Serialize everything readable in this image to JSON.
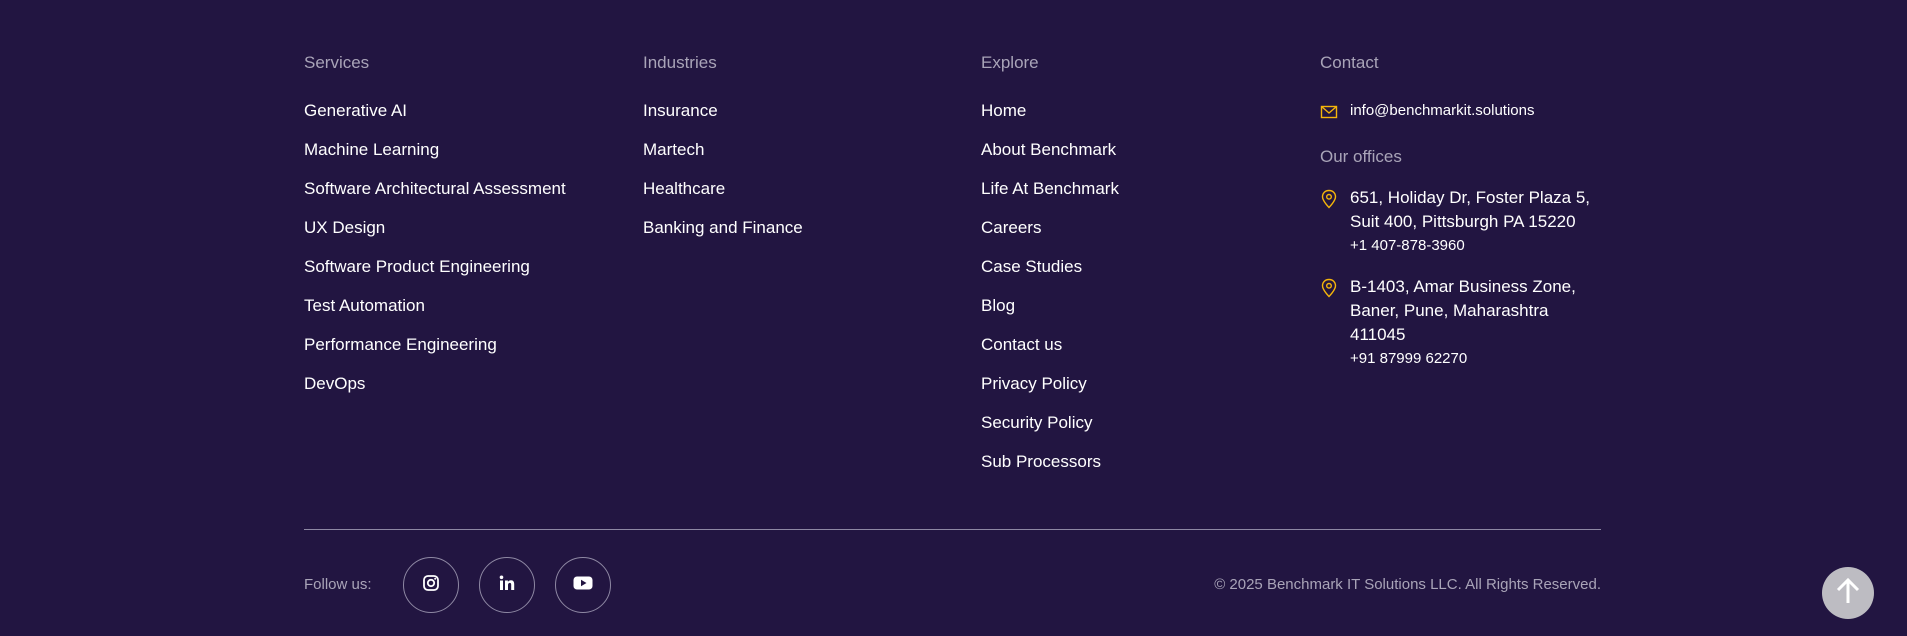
{
  "services": {
    "title": "Services",
    "items": [
      "Generative AI",
      "Machine Learning",
      "Software Architectural Assessment",
      "UX Design",
      "Software Product Engineering",
      "Test Automation",
      "Performance Engineering",
      "DevOps"
    ]
  },
  "industries": {
    "title": "Industries",
    "items": [
      "Insurance",
      "Martech",
      "Healthcare",
      "Banking and Finance"
    ]
  },
  "explore": {
    "title": "Explore",
    "items": [
      "Home",
      "About Benchmark",
      "Life At Benchmark",
      "Careers",
      "Case Studies",
      "Blog",
      "Contact us",
      "Privacy Policy",
      "Security Policy",
      "Sub Processors"
    ]
  },
  "contact": {
    "title": "Contact",
    "email": "info@benchmarkit.solutions",
    "email_icon": "mail-icon",
    "offices_title": "Our offices",
    "offices": [
      {
        "address": "651, Holiday Dr, Foster Plaza 5, Suit 400, Pittsburgh PA 15220",
        "phone": "+1 407-878-3960",
        "icon": "location-pin-icon"
      },
      {
        "address": "B-1403, Amar Business Zone, Baner, Pune, Maharashtra 411045",
        "phone": "+91 87999 62270",
        "icon": "location-pin-icon"
      }
    ]
  },
  "bottom": {
    "follow_label": "Follow us:",
    "socials": [
      "instagram-icon",
      "linkedin-icon",
      "youtube-icon"
    ],
    "copyright": "© 2025 Benchmark IT Solutions LLC. All Rights Reserved.",
    "scroll_top_icon": "arrow-up-icon"
  },
  "colors": {
    "background": "#221541",
    "accent": "#f5b50a",
    "muted_text": "#a9a4b8",
    "scroll_button": "#bdbcc2"
  }
}
